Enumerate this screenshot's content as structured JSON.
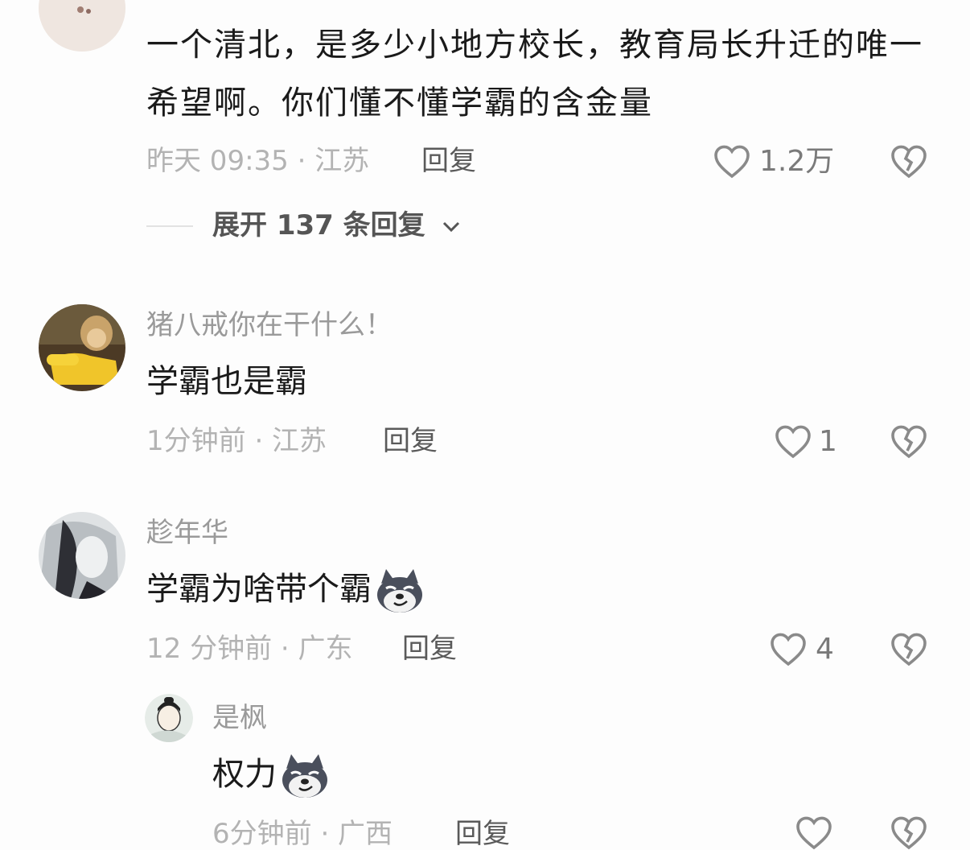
{
  "comments": [
    {
      "text": "一个清北，是多少小地方校长，教育局长升迁的唯一希望啊。你们懂不懂学霸的含金量",
      "meta": "昨天 09:35 · 江苏",
      "reply_label": "回复",
      "likes": "1.2万",
      "expand_label": "展开 137 条回复"
    },
    {
      "username": "猪八戒你在干什么！",
      "text": "学霸也是霸",
      "meta": "1分钟前 · 江苏",
      "reply_label": "回复",
      "likes": "1"
    },
    {
      "username": "趁年华",
      "text": "学霸为啥带个霸",
      "meta": "12 分钟前 · 广东",
      "reply_label": "回复",
      "likes": "4"
    }
  ],
  "sub_reply": {
    "username": "是枫",
    "text": "权力",
    "meta": "6分钟前 · 广西",
    "reply_label": "回复"
  },
  "colors": {
    "icon_gray": "#8a8a8a",
    "text_dark": "#1a1a1a"
  }
}
